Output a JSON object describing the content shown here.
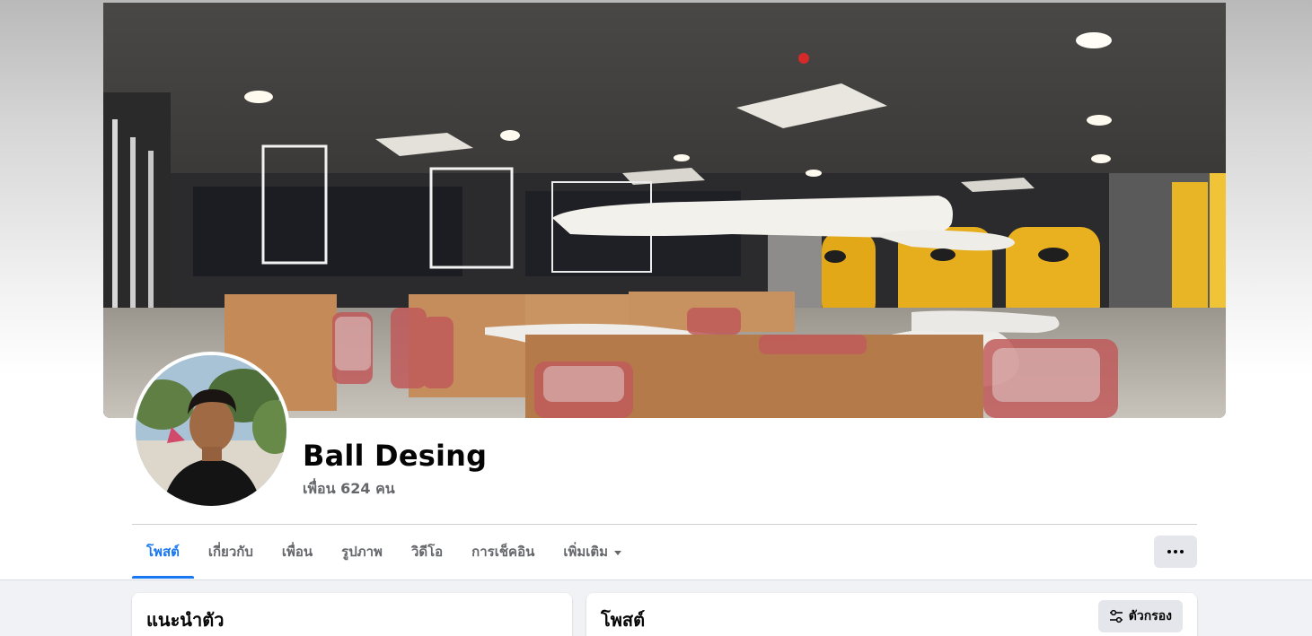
{
  "profile": {
    "name": "Ball Desing",
    "friends_text": "เพื่อน 624 คน"
  },
  "tabs": [
    {
      "label": "โพสต์",
      "active": true
    },
    {
      "label": "เกี่ยวกับ"
    },
    {
      "label": "เพื่อน"
    },
    {
      "label": "รูปภาพ"
    },
    {
      "label": "วิดีโอ"
    },
    {
      "label": "การเช็คอิน"
    },
    {
      "label": "เพิ่มเติม",
      "dropdown": true
    }
  ],
  "intro_card": {
    "title": "แนะนำตัว"
  },
  "posts_card": {
    "title": "โพสต์",
    "filter_label": "ตัวกรอง"
  },
  "icons": {
    "more": "more-horizontal-icon",
    "filter": "filter-sliders-icon",
    "dropdown": "caret-down-icon"
  },
  "colors": {
    "accent": "#1877f2",
    "secondary_text": "#65676b",
    "button_bg": "#e4e6eb",
    "page_bg": "#f0f2f5"
  }
}
